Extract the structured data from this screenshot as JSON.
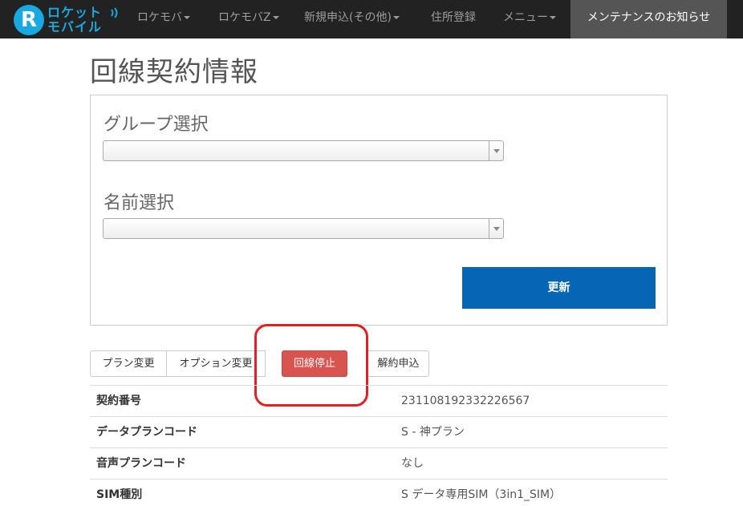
{
  "logo": {
    "letter": "R",
    "line1": "ロケット",
    "line2": "モバイル"
  },
  "navbar": {
    "items": [
      {
        "label": "ロケモバ"
      },
      {
        "label": "ロケモバZ"
      },
      {
        "label": "新規申込(その他)"
      },
      {
        "label": "住所登録"
      },
      {
        "label": "メニュー"
      }
    ],
    "active_label": "メンテナンスのお知らせ"
  },
  "page": {
    "title": "回線契約情報"
  },
  "form": {
    "group_label": "グループ選択",
    "group_value": "",
    "name_label": "名前選択",
    "name_value": "",
    "update_label": "更新"
  },
  "actions": {
    "plan_change": "プラン変更",
    "option_change": "オプション変更",
    "line_suspend": "回線停止",
    "cancel_contract": "解約申込"
  },
  "info": {
    "rows": [
      {
        "key": "契約番号",
        "value": "231108192332226567"
      },
      {
        "key": "データプランコード",
        "value": "S - 神プラン"
      },
      {
        "key": "音声プランコード",
        "value": "なし"
      },
      {
        "key": "SIM種別",
        "value": "S データ専用SIM（3in1_SIM）"
      }
    ]
  },
  "colors": {
    "navbar_bg": "#222222",
    "accent_blue": "#0765b6",
    "danger": "#d9534f",
    "highlight": "#e61e1e",
    "logo": "#17a9e1"
  }
}
